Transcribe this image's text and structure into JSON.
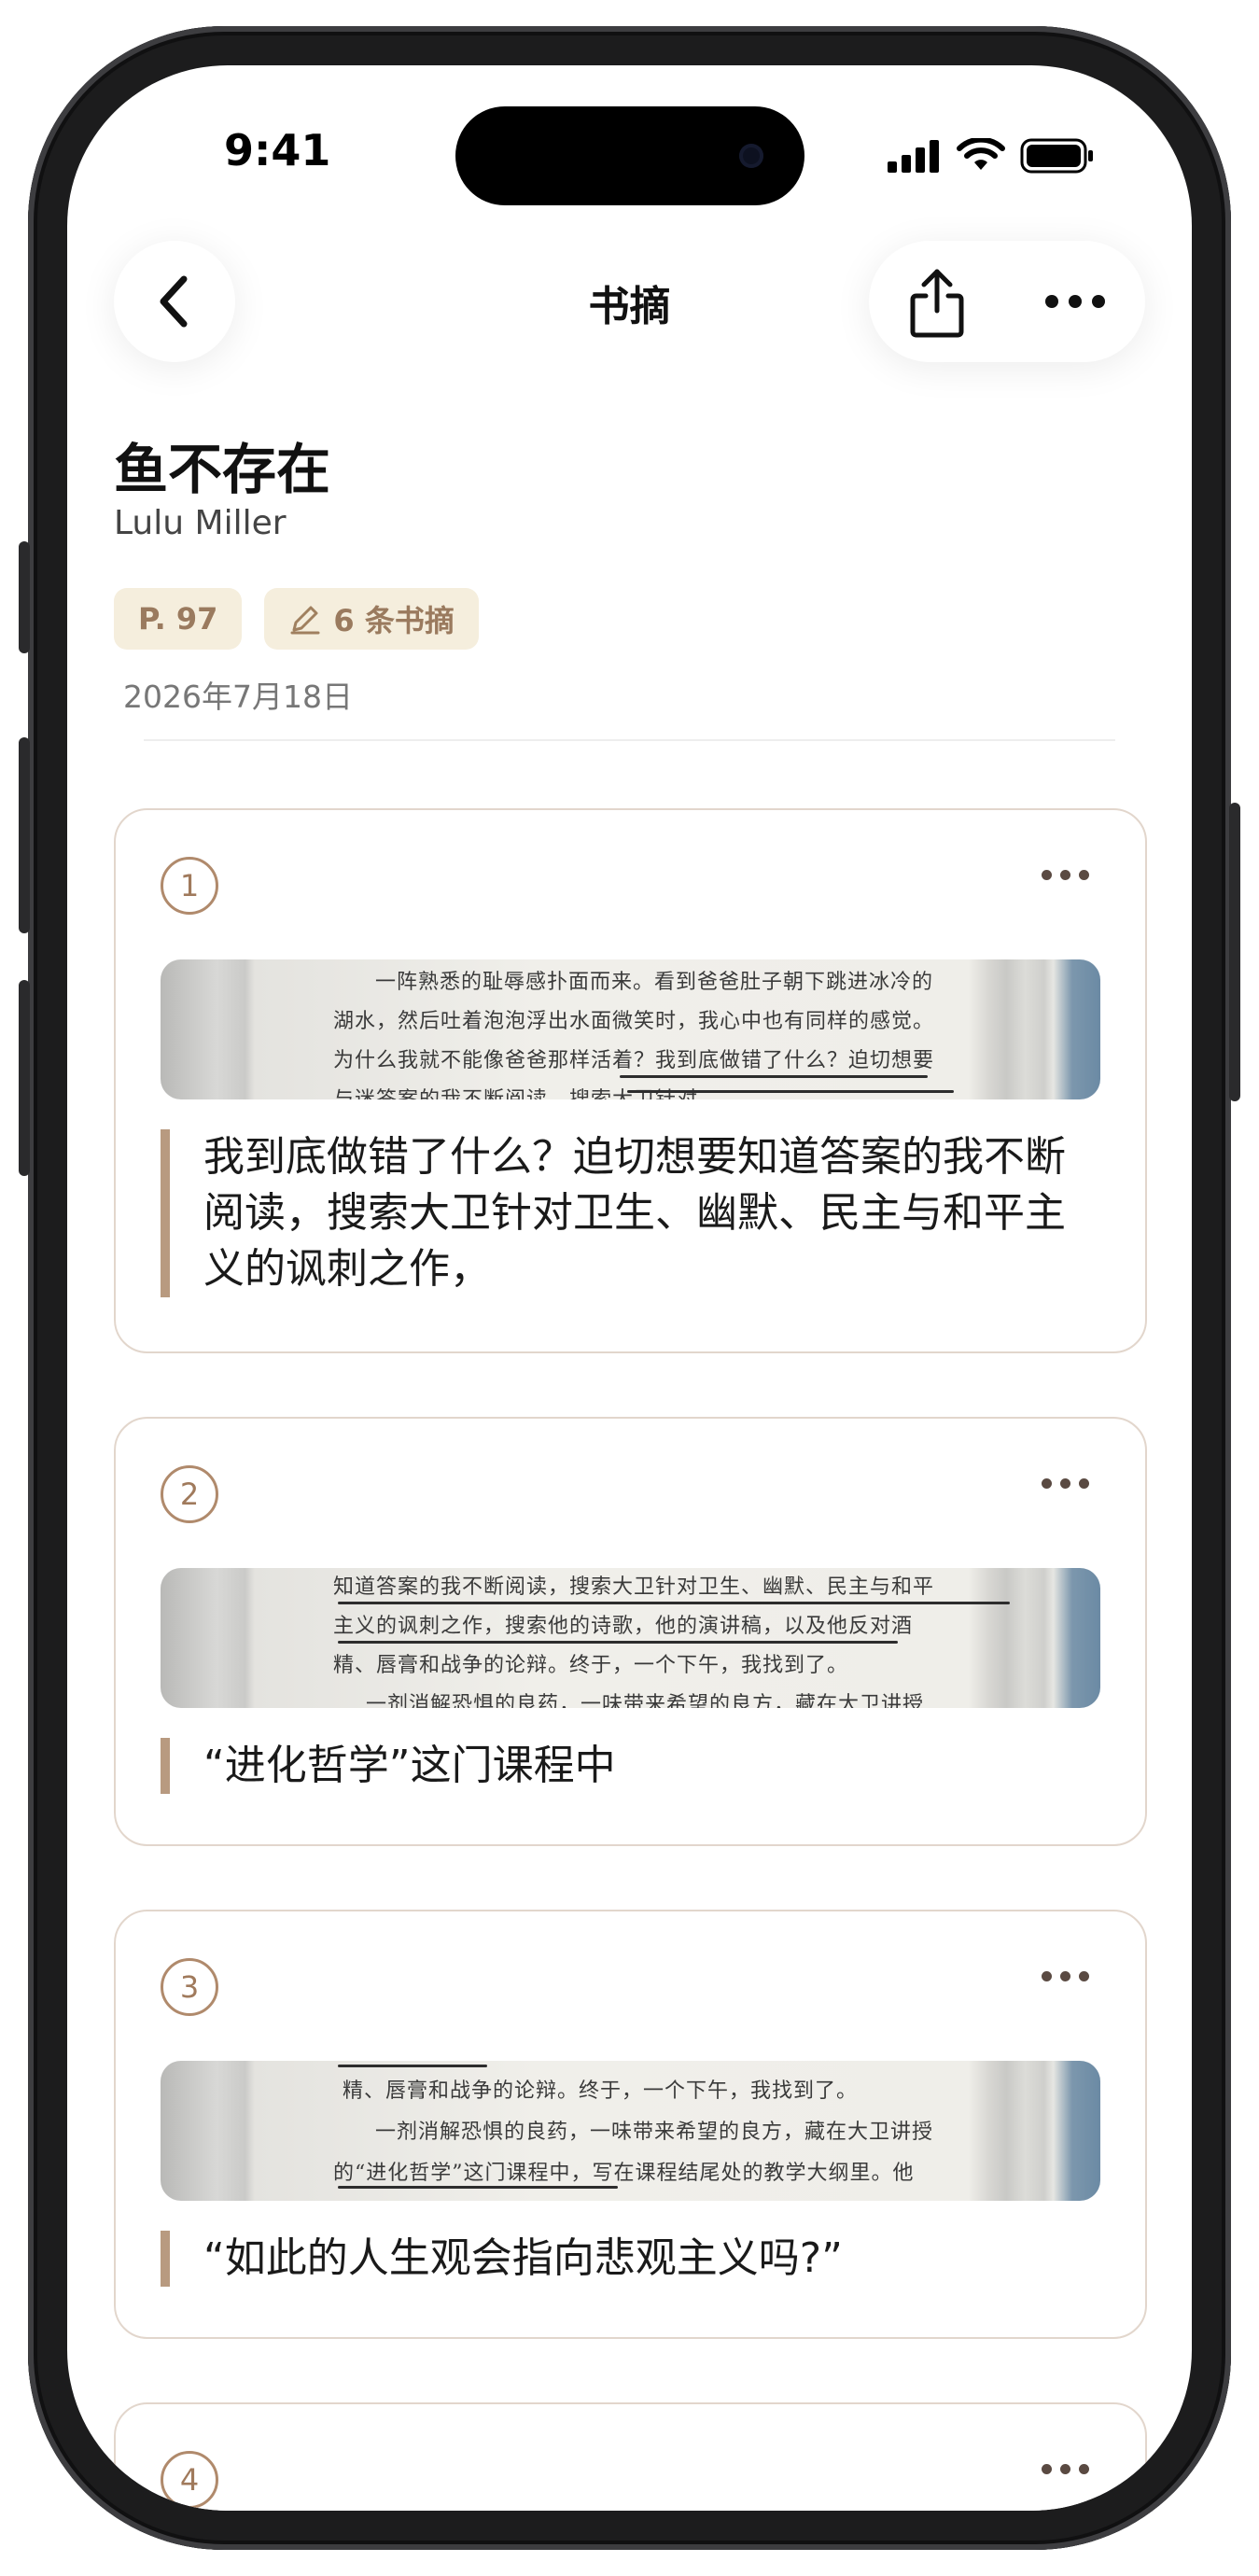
{
  "status": {
    "time": "9:41"
  },
  "nav": {
    "title": "书摘"
  },
  "book": {
    "title": "鱼不存在",
    "author": "Lulu Miller",
    "page_chip": "P. 97",
    "excerpt_chip": "6 条书摘",
    "date": "2026年7月18日"
  },
  "excerpts": [
    {
      "number": "1",
      "quote": "我到底做错了什么？迫切想要知道答案的我不断阅读，搜索大卫针对卫生、幽默、民主与和平主义的讽刺之作，",
      "photo_lines": [
        "一阵熟悉的耻辱感扑面而来。看到爸爸肚子朝下跳进冰冷的",
        "湖水，然后吐着泡泡浮出水面微笑时，我心中也有同样的感觉。",
        "为什么我就不能像爸爸那样活着？我到底做错了什么？迫切想要",
        "与迷答案的我不断阅读，搜索大卫针对"
      ]
    },
    {
      "number": "2",
      "quote": "“进化哲学”这门课程中",
      "photo_lines": [
        "知道答案的我不断阅读，搜索大卫针对卫生、幽默、民主与和平",
        "主义的讽刺之作，搜索他的诗歌，他的演讲稿，以及他反对酒",
        "精、唇膏和战争的论辩。终于，一个下午，我找到了。",
        "一剂消解恐惧的良药，一味带来希望的良方，藏在大卫讲授"
      ]
    },
    {
      "number": "3",
      "quote": "“如此的人生观会指向悲观主义吗?”",
      "photo_lines": [
        "精、唇膏和战争的论辩。终于，一个下午，我找到了。",
        "一剂消解恐惧的良药，一味带来希望的良方，藏在大卫讲授",
        "的“进化哲学”这门课程中，写在课程结尾处的教学大纲里。他"
      ]
    },
    {
      "number": "4"
    }
  ]
}
